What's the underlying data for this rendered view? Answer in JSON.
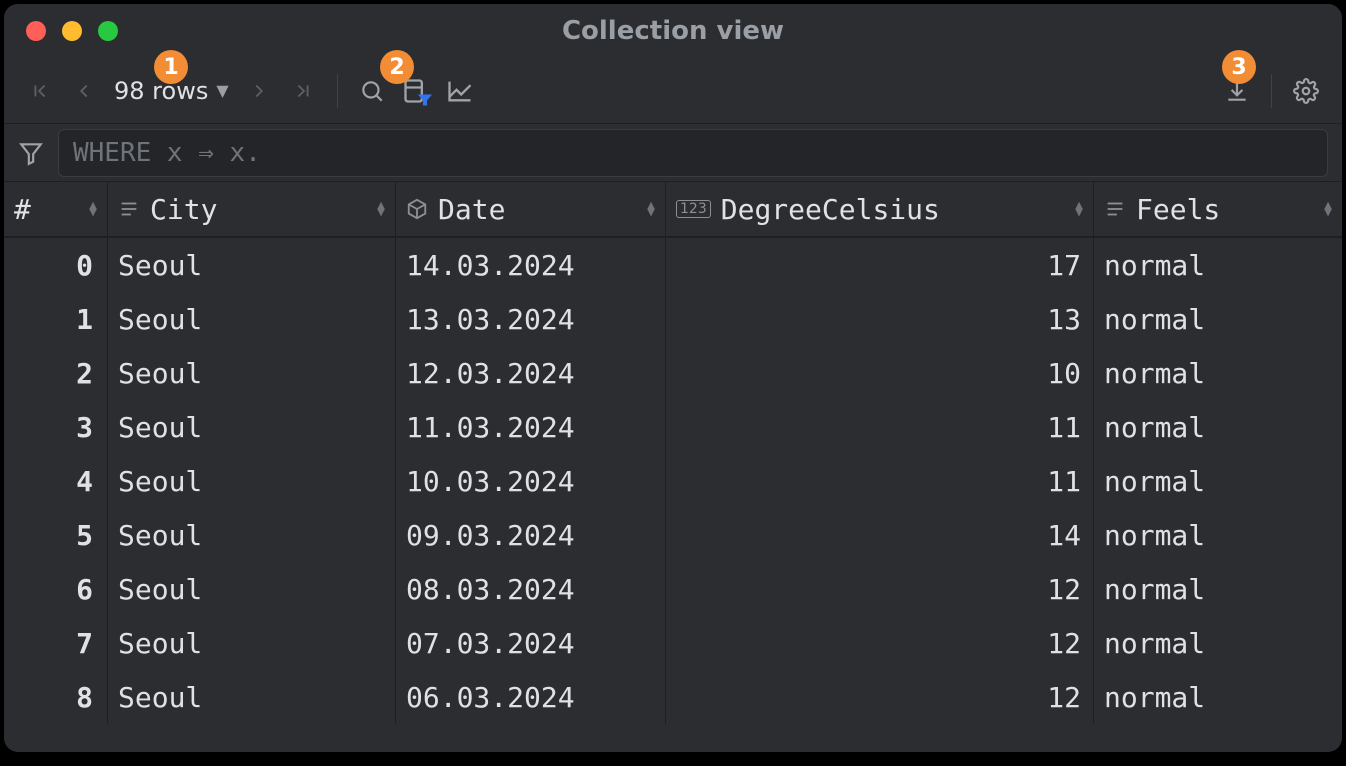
{
  "window": {
    "title": "Collection view"
  },
  "toolbar": {
    "rows_label": "98 rows"
  },
  "filter": {
    "placeholder_kw": "WHERE",
    "placeholder_var1": " x ",
    "placeholder_arrow": "⇒",
    "placeholder_var2": " x."
  },
  "annotations": {
    "badge1": "1",
    "badge2": "2",
    "badge3": "3"
  },
  "columns": {
    "index": "#",
    "city": "City",
    "date": "Date",
    "degree": "DegreeCelsius",
    "feels": "Feels"
  },
  "rows": [
    {
      "idx": "0",
      "city": "Seoul",
      "date": "14.03.2024",
      "degree": "17",
      "feels": "normal"
    },
    {
      "idx": "1",
      "city": "Seoul",
      "date": "13.03.2024",
      "degree": "13",
      "feels": "normal"
    },
    {
      "idx": "2",
      "city": "Seoul",
      "date": "12.03.2024",
      "degree": "10",
      "feels": "normal"
    },
    {
      "idx": "3",
      "city": "Seoul",
      "date": "11.03.2024",
      "degree": "11",
      "feels": "normal"
    },
    {
      "idx": "4",
      "city": "Seoul",
      "date": "10.03.2024",
      "degree": "11",
      "feels": "normal"
    },
    {
      "idx": "5",
      "city": "Seoul",
      "date": "09.03.2024",
      "degree": "14",
      "feels": "normal"
    },
    {
      "idx": "6",
      "city": "Seoul",
      "date": "08.03.2024",
      "degree": "12",
      "feels": "normal"
    },
    {
      "idx": "7",
      "city": "Seoul",
      "date": "07.03.2024",
      "degree": "12",
      "feels": "normal"
    },
    {
      "idx": "8",
      "city": "Seoul",
      "date": "06.03.2024",
      "degree": "12",
      "feels": "normal"
    }
  ]
}
